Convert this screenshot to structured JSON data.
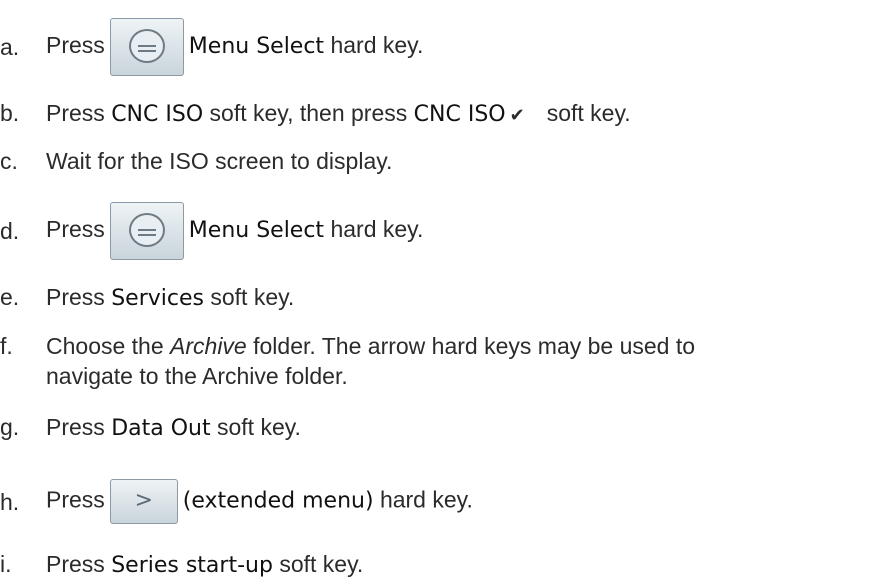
{
  "steps": [
    {
      "letter": "a.",
      "pre": "Press",
      "key": "menu-select",
      "bold": "Menu Select",
      "post": "hard key."
    },
    {
      "letter": "b.",
      "pre": "Press",
      "bold": "CNC ISO",
      "mid": "soft key, then press",
      "bold2": "CNC ISO",
      "check": "✔",
      "post": "soft key."
    },
    {
      "letter": "c.",
      "text": "Wait for the ISO screen to display."
    },
    {
      "letter": "d.",
      "pre": "Press",
      "key": "menu-select",
      "bold": "Menu Select",
      "post": "hard key."
    },
    {
      "letter": "e.",
      "pre": "Press",
      "bold": "Services",
      "post": "soft key."
    },
    {
      "letter": "f.",
      "pre": "Choose the",
      "italic": "Archive",
      "line1_post": "folder. The arrow hard keys may be used to",
      "line2": "navigate to the Archive folder."
    },
    {
      "letter": "g.",
      "pre": "Press",
      "bold": "Data Out",
      "post": "soft key."
    },
    {
      "letter": "h.",
      "pre": "Press",
      "key": "extended-menu",
      "key_glyph": ">",
      "bold": "(extended menu)",
      "post": "hard key."
    },
    {
      "letter": "i.",
      "pre": "Press",
      "bold": "Series start-up",
      "post": "soft key."
    }
  ]
}
